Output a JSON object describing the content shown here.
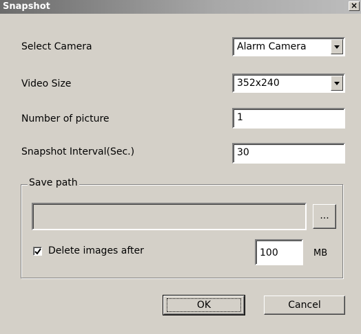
{
  "window": {
    "title": "Snapshot",
    "close_glyph": "×"
  },
  "form": {
    "select_camera_label": "Select Camera",
    "select_camera_value": "Alarm Camera",
    "video_size_label": "Video Size",
    "video_size_value": "352x240",
    "number_of_picture_label": "Number of picture",
    "number_of_picture_value": "1",
    "snapshot_interval_label": "Snapshot Interval(Sec.)",
    "snapshot_interval_value": "30"
  },
  "save_path": {
    "legend": "Save path",
    "path_value": "",
    "browse_label": "...",
    "delete_label": "Delete images after",
    "delete_checked": true,
    "size_value": "100",
    "unit": "MB"
  },
  "buttons": {
    "ok": "OK",
    "cancel": "Cancel"
  }
}
